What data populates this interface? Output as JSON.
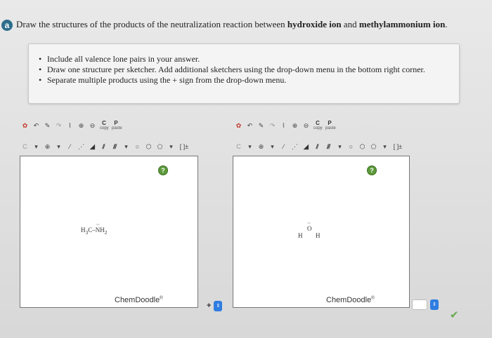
{
  "question": {
    "part_label": "a",
    "text_before": "Draw the structures of the products of the neutralization reaction between ",
    "reactant1": "hydroxide ion",
    "text_and": " and ",
    "reactant2": "methylammonium ion",
    "text_end": "."
  },
  "instructions": [
    "Include all valence lone pairs in your answer.",
    "Draw one structure per sketcher. Add additional sketchers using the drop-down menu in the bottom right corner.",
    "Separate multiple products using the + sign from the drop-down menu."
  ],
  "sketchers": [
    {
      "molecule": {
        "left": "H",
        "left_sub": "3",
        "mid": "C–",
        "right": "N",
        "lone_pair": "··",
        "right_h": "H",
        "right_sub": "2"
      },
      "brand": "ChemDoodle",
      "help": "?",
      "copy_label": "C",
      "copy_sub": "copy",
      "paste_label": "P",
      "paste_sub": "paste",
      "bracket_label": "[ ]±"
    },
    {
      "molecule": {
        "h1": "H",
        "o": "O",
        "o_dots": "··",
        "o_charge": "−",
        "h2": "H"
      },
      "brand": "ChemDoodle",
      "help": "?",
      "copy_label": "C",
      "copy_sub": "copy",
      "paste_label": "P",
      "paste_sub": "paste",
      "bracket_label": "[ ]±"
    }
  ],
  "controls": {
    "add_symbol": "+",
    "stepper_symbol": "⇕",
    "check_symbol": "✔"
  },
  "colors": {
    "badge": "#2d6d8c",
    "help": "#5c9a3a",
    "stepper": "#2f7de1",
    "check": "#6aa84f"
  }
}
